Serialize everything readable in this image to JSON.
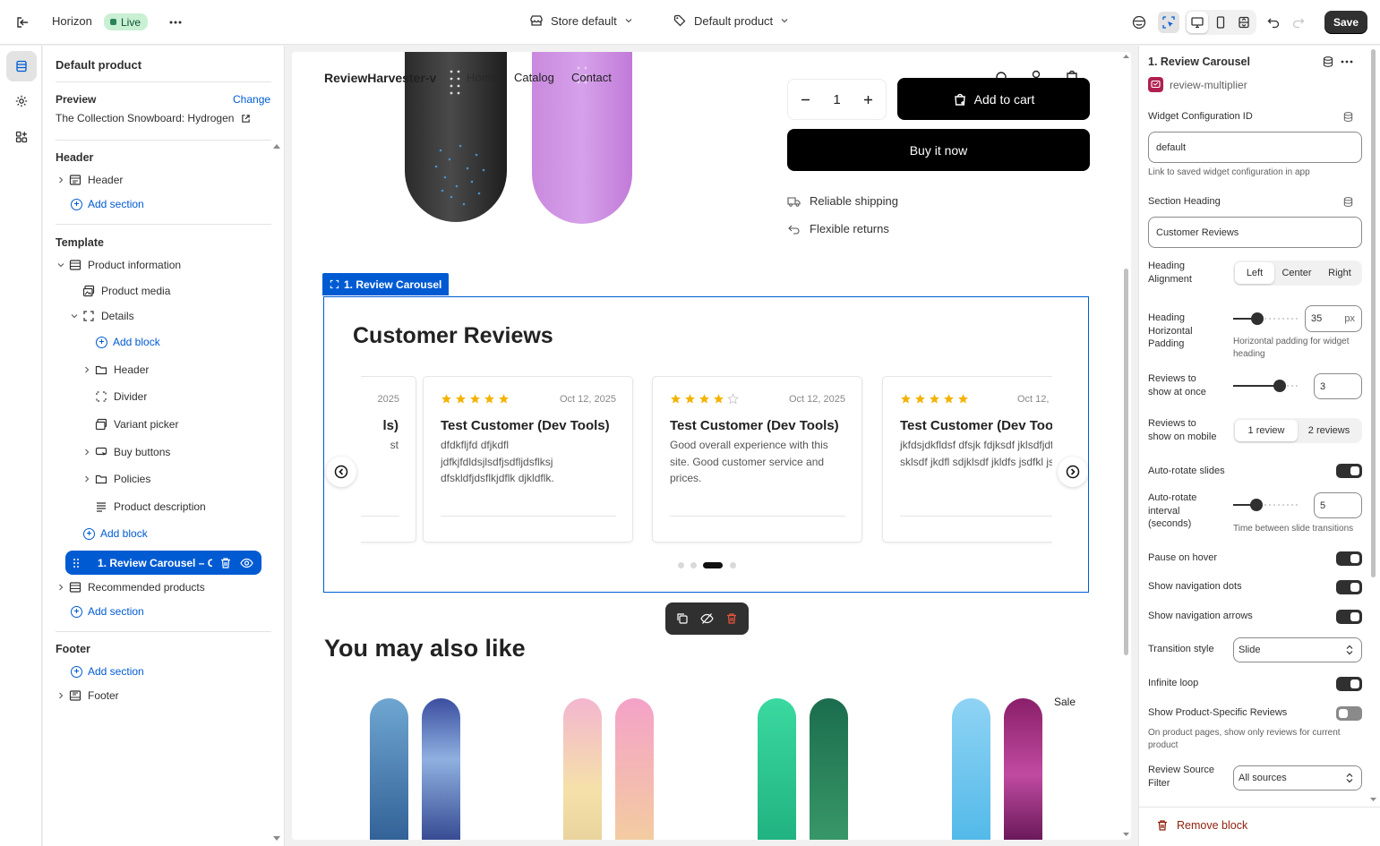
{
  "topbar": {
    "store_name": "Horizon",
    "live_label": "Live",
    "context_store": "Store default",
    "context_template": "Default product",
    "save_label": "Save"
  },
  "left_panel": {
    "title": "Default product",
    "preview_label": "Preview",
    "change_label": "Change",
    "preview_product": "The Collection Snowboard: Hydrogen",
    "header_group": "Header",
    "header_item": "Header",
    "add_section": "Add section",
    "template_group": "Template",
    "product_information": "Product information",
    "product_media": "Product media",
    "details": "Details",
    "add_block": "Add block",
    "details_children": [
      "Header",
      "Divider",
      "Variant picker",
      "Buy buttons",
      "Policies",
      "Product description"
    ],
    "selected_block": "1. Review Carousel – C...",
    "recommended_products": "Recommended products",
    "footer_group": "Footer",
    "footer_item": "Footer"
  },
  "preview": {
    "store_logo": "ReviewHarvester-v",
    "nav": [
      "Home",
      "Catalog",
      "Contact"
    ],
    "quantity": "1",
    "add_to_cart": "Add to cart",
    "buy_now": "Buy it now",
    "features": [
      "Reliable shipping",
      "Flexible returns"
    ],
    "block_tag": "1. Review Carousel",
    "carousel_heading": "Customer Reviews",
    "reviews": [
      {
        "partial_date": "2025",
        "partial_name": "ls)",
        "partial_body": "st"
      },
      {
        "stars": 5,
        "date": "Oct 12, 2025",
        "name": "Test Customer (Dev Tools)",
        "body": "dfdkfljfd dfjkdfl jdfkjfdldsjlsdfjsdfljdsflksj dfskldfjdsflkjdflk djkldflk."
      },
      {
        "stars": 4,
        "date": "Oct 12, 2025",
        "name": "Test Customer (Dev Tools)",
        "body": "Good overall experience with this site. Good customer service and prices."
      },
      {
        "stars": 5,
        "date": "Oct 12,",
        "name": "Test Customer (Dev Tool",
        "body": "jkfdsjdkfldsf dfsjk fdjksdf jklsdfjdf sklsdf jkdfl sdjklsdf jkldfs jsdfkl jsdfkl."
      }
    ],
    "active_dot": 3,
    "dot_count": 4,
    "also_like_heading": "You may also like",
    "sale_badge": "Sale"
  },
  "right_panel": {
    "block_title": "1. Review Carousel",
    "app_name": "review-multiplier",
    "widget_config_label": "Widget Configuration ID",
    "widget_config_value": "default",
    "widget_config_help": "Link to saved widget configuration in app",
    "section_heading_label": "Section Heading",
    "section_heading_value": "Customer Reviews",
    "heading_alignment_label": "Heading Alignment",
    "alignment_options": [
      "Left",
      "Center",
      "Right"
    ],
    "alignment_selected": "Left",
    "heading_padding_label": "Heading Horizontal Padding",
    "heading_padding_value": "35",
    "heading_padding_unit": "px",
    "heading_padding_fraction": 0.38,
    "heading_padding_help": "Horizontal padding for widget heading",
    "reviews_at_once_label": "Reviews to show at once",
    "reviews_at_once_value": "3",
    "reviews_at_once_fraction": 0.72,
    "reviews_mobile_label": "Reviews to show on mobile",
    "mobile_options": [
      "1 review",
      "2 reviews"
    ],
    "mobile_selected": "1 review",
    "auto_rotate_label": "Auto-rotate slides",
    "auto_rotate_interval_label": "Auto-rotate interval (seconds)",
    "auto_rotate_interval_value": "5",
    "auto_rotate_interval_fraction": 0.36,
    "auto_rotate_interval_help": "Time between slide transitions",
    "pause_hover_label": "Pause on hover",
    "show_dots_label": "Show navigation dots",
    "show_arrows_label": "Show navigation arrows",
    "transition_label": "Transition style",
    "transition_value": "Slide",
    "infinite_loop_label": "Infinite loop",
    "product_specific_label": "Show Product-Specific Reviews",
    "product_specific_help": "On product pages, show only reviews for current product",
    "source_filter_label": "Review Source Filter",
    "source_filter_value": "All sources",
    "remove_block": "Remove block"
  },
  "colors": {
    "accent": "#005bd3",
    "star": "#f5b300",
    "dark": "#303030",
    "danger": "#8e1f0b"
  }
}
